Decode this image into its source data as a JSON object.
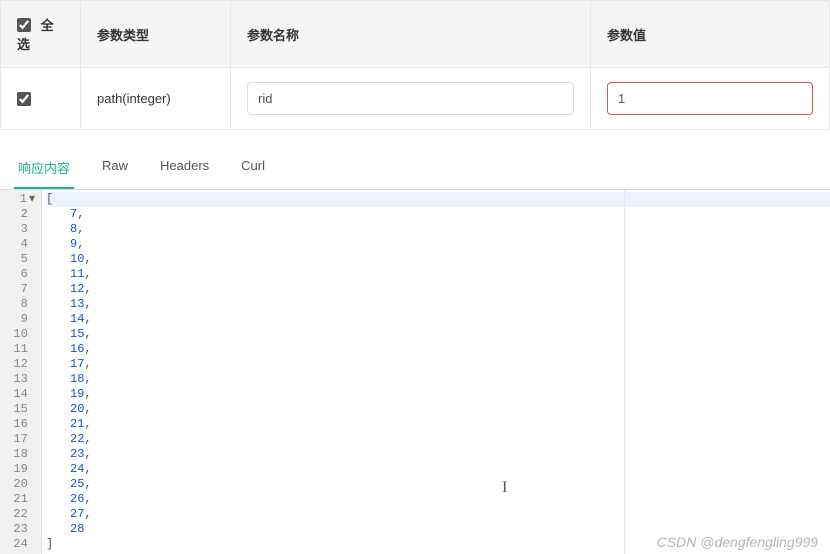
{
  "paramTable": {
    "headers": {
      "selectAll": "全选",
      "type": "参数类型",
      "name": "参数名称",
      "value": "参数值"
    },
    "row": {
      "checked": true,
      "type": "path(integer)",
      "name": "rid",
      "value": "1"
    }
  },
  "tabs": {
    "response": "响应内容",
    "raw": "Raw",
    "headers": "Headers",
    "curl": "Curl",
    "activeIndex": 0
  },
  "responseJson": {
    "openBracket": "[",
    "values": [
      7,
      8,
      9,
      10,
      11,
      12,
      13,
      14,
      15,
      16,
      17,
      18,
      19,
      20,
      21,
      22,
      23,
      24,
      25,
      26,
      27,
      28
    ],
    "closeBracket": "]",
    "totalLines": 24
  },
  "watermark": "CSDN @dengfengling999"
}
